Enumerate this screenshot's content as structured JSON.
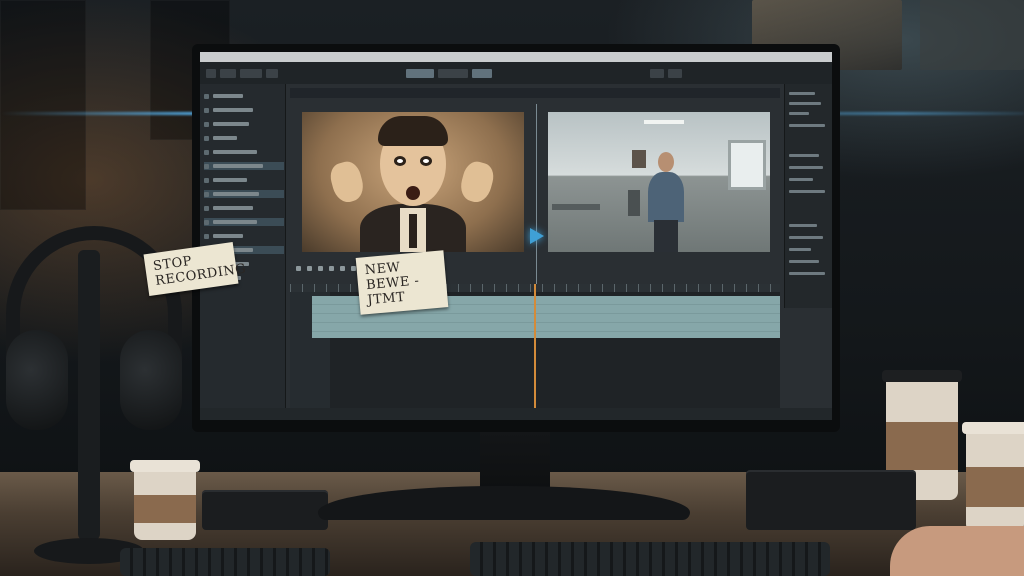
{
  "scene": {
    "description_visible": false
  },
  "timeline": {
    "note_left": "STOP RECORDING",
    "note_right": "NEW BEWE - JTMT"
  },
  "icons": {
    "play": "play-arrow-icon",
    "headphones": "headphones-icon"
  },
  "colors": {
    "accent": "#3fa0d6",
    "playhead": "#d38b3a",
    "clip": "#86a7a9"
  }
}
